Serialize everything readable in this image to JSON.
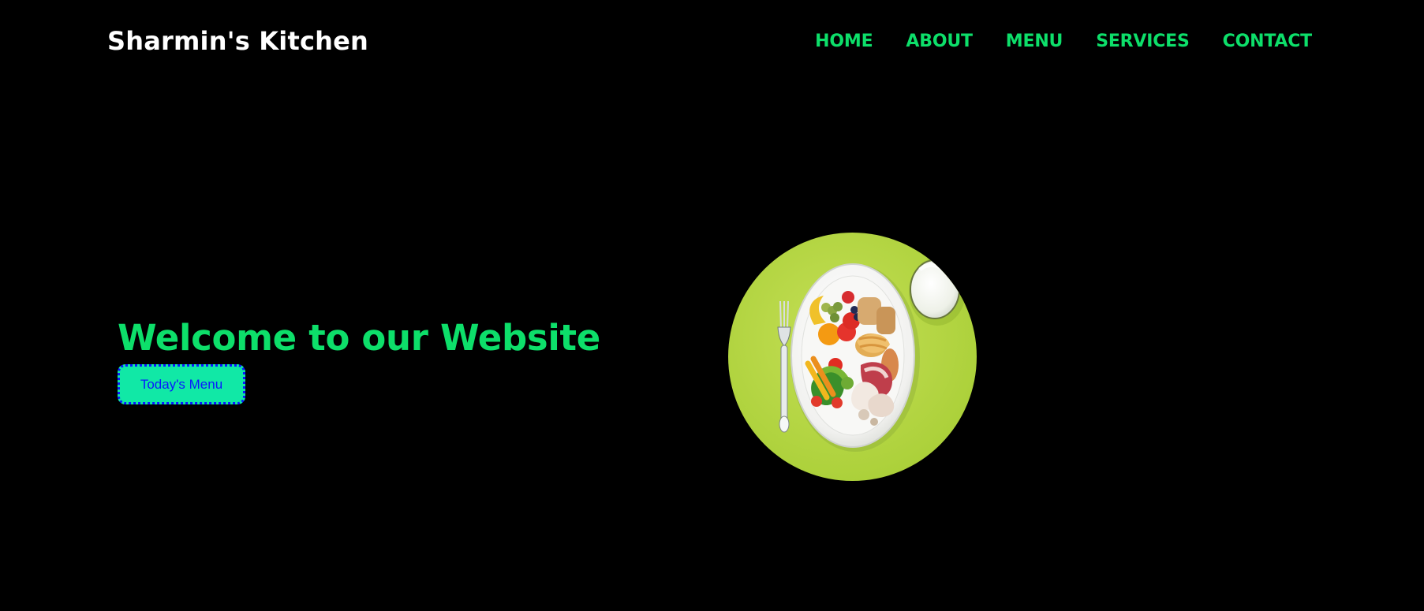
{
  "site": {
    "logo": "Sharmin's Kitchen"
  },
  "navigation": {
    "items": [
      {
        "label": "HOME"
      },
      {
        "label": "ABOUT"
      },
      {
        "label": "MENU"
      },
      {
        "label": "SERVICES"
      },
      {
        "label": "CONTACT"
      }
    ]
  },
  "hero": {
    "title": "Welcome to our Website",
    "button_label": "Today's Menu",
    "image": {
      "icon": "healthy-meal-plate-image"
    }
  },
  "colors": {
    "background": "#000000",
    "accent": "#0ddf6a",
    "button_fill": "#11e8a6",
    "button_text": "#0b18ff",
    "plate_background": "#b8d84b"
  }
}
